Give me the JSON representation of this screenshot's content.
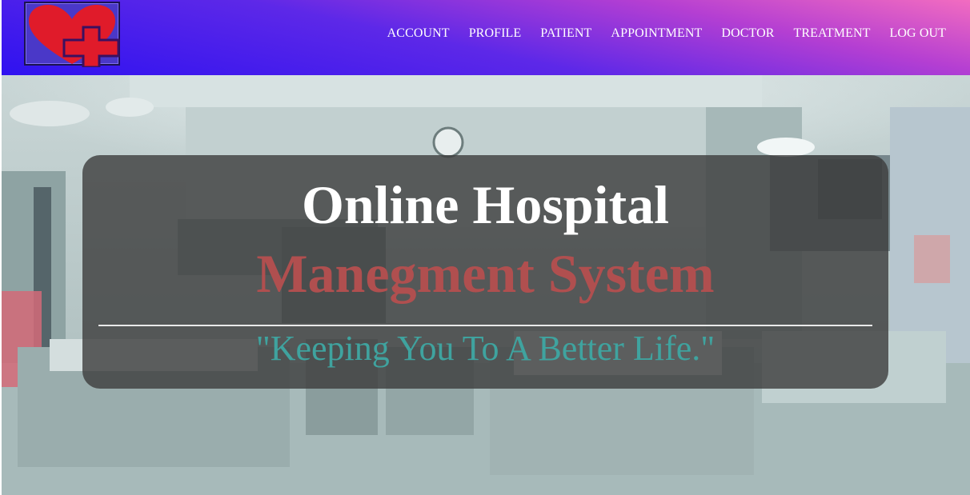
{
  "colors": {
    "nav_gradient_start": "#2f12f0",
    "nav_gradient_end": "#f26cc0",
    "heart": "#e01b2a",
    "cross": "#e01b2a",
    "title_primary": "#ffffff",
    "title_secondary": "#b04f4f",
    "tagline": "#3fa39f",
    "overlay": "rgba(60,60,60,0.80)"
  },
  "logo": {
    "icon": "heart-with-cross-icon"
  },
  "nav": {
    "items": [
      {
        "label": "ACCOUNT"
      },
      {
        "label": "PROFILE"
      },
      {
        "label": "PATIENT"
      },
      {
        "label": "APPOINTMENT"
      },
      {
        "label": "DOCTOR"
      },
      {
        "label": "TREATMENT"
      },
      {
        "label": "LOG OUT"
      }
    ]
  },
  "hero": {
    "title_line1": "Online Hospital",
    "title_line2": "Manegment System",
    "tagline": "\"Keeping You To A Better Life.\""
  }
}
